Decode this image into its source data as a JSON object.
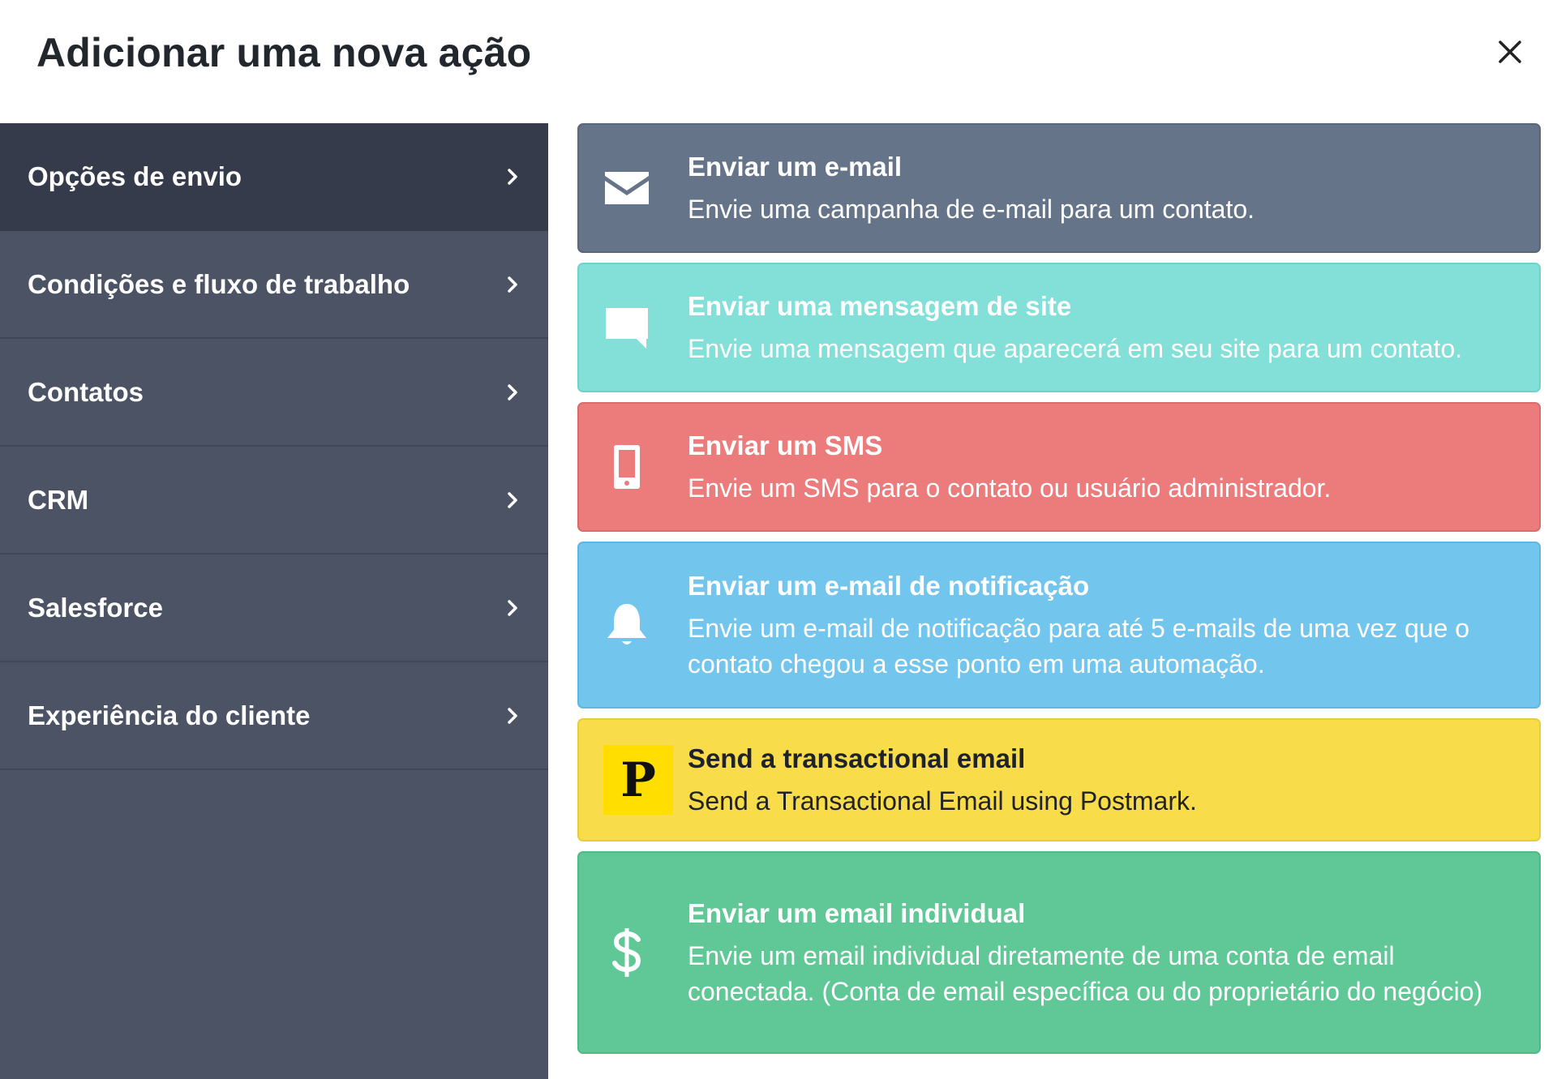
{
  "modal": {
    "title": "Adicionar uma nova ação",
    "close_icon": "close-icon"
  },
  "sidebar": {
    "items": [
      {
        "label": "Opções de envio",
        "active": true,
        "icon": "chevron-right-icon"
      },
      {
        "label": "Condições e fluxo de trabalho",
        "active": false,
        "icon": "chevron-right-icon"
      },
      {
        "label": "Contatos",
        "active": false,
        "icon": "chevron-right-icon"
      },
      {
        "label": "CRM",
        "active": false,
        "icon": "chevron-right-icon"
      },
      {
        "label": "Salesforce",
        "active": false,
        "icon": "chevron-right-icon"
      },
      {
        "label": "Experiência do cliente",
        "active": false,
        "icon": "chevron-right-icon"
      }
    ]
  },
  "actions": [
    {
      "title": "Enviar um e-mail",
      "description": "Envie uma campanha de e-mail para um contato.",
      "icon": "envelope-icon",
      "color": "#667489"
    },
    {
      "title": "Enviar uma mensagem de site",
      "description": "Envie uma mensagem que aparecerá em seu site para um contato.",
      "icon": "chat-bubble-icon",
      "color": "#82e0d8"
    },
    {
      "title": "Enviar um SMS",
      "description": "Envie um SMS para o contato ou usuário administrador.",
      "icon": "mobile-phone-icon",
      "color": "#ec7b7b"
    },
    {
      "title": "Enviar um e-mail de notificação",
      "description": "Envie um e-mail de notificação para até 5 e-mails de uma vez que o contato chegou a esse ponto em uma automação.",
      "icon": "bell-icon",
      "color": "#72c5ec"
    },
    {
      "title": "Send a transactional email",
      "description": "Send a Transactional Email using Postmark.",
      "icon": "postmark-logo-icon",
      "logo_letter": "P",
      "color": "#f8dc49"
    },
    {
      "title": "Enviar um email individual",
      "description": "Envie um email individual diretamente de uma conta de email conectada. (Conta de email específica ou do proprietário do negócio)",
      "icon": "dollar-icon",
      "color": "#60c896"
    }
  ]
}
